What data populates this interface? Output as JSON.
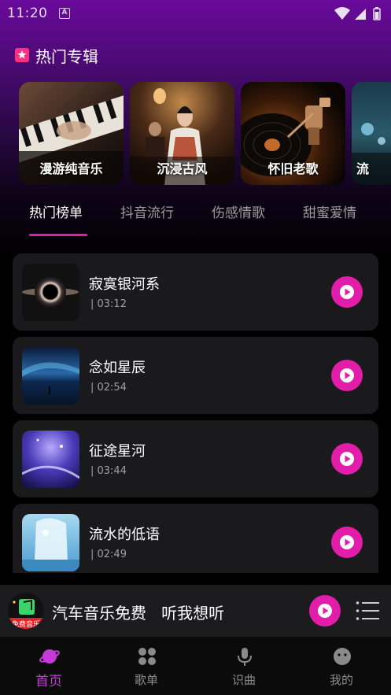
{
  "status_bar": {
    "time": "11:20",
    "notification_letter": "A"
  },
  "section": {
    "title": "热门专辑"
  },
  "albums": [
    {
      "label": "漫游纯音乐"
    },
    {
      "label": "沉浸古风"
    },
    {
      "label": "怀旧老歌"
    },
    {
      "label": "流"
    }
  ],
  "tabs": [
    {
      "label": "热门榜单"
    },
    {
      "label": "抖音流行"
    },
    {
      "label": "伤感情歌"
    },
    {
      "label": "甜蜜爱情"
    }
  ],
  "songs": [
    {
      "title": "寂寞银河系",
      "duration": "| 03:12"
    },
    {
      "title": "念如星辰",
      "duration": "| 02:54"
    },
    {
      "title": "征途星河",
      "duration": "| 03:44"
    },
    {
      "title": "流水的低语",
      "duration": "| 02:49"
    }
  ],
  "mini_player": {
    "text": "汽车音乐免费   听我想听",
    "logo_text": "免费音乐"
  },
  "nav": [
    {
      "label": "首页"
    },
    {
      "label": "歌单"
    },
    {
      "label": "识曲"
    },
    {
      "label": "我的"
    }
  ],
  "colors": {
    "accent": "#e21da9",
    "nav_active": "#c43bd8",
    "card_bg": "#1a1a1d",
    "header_purple": "#6a0a9c"
  }
}
